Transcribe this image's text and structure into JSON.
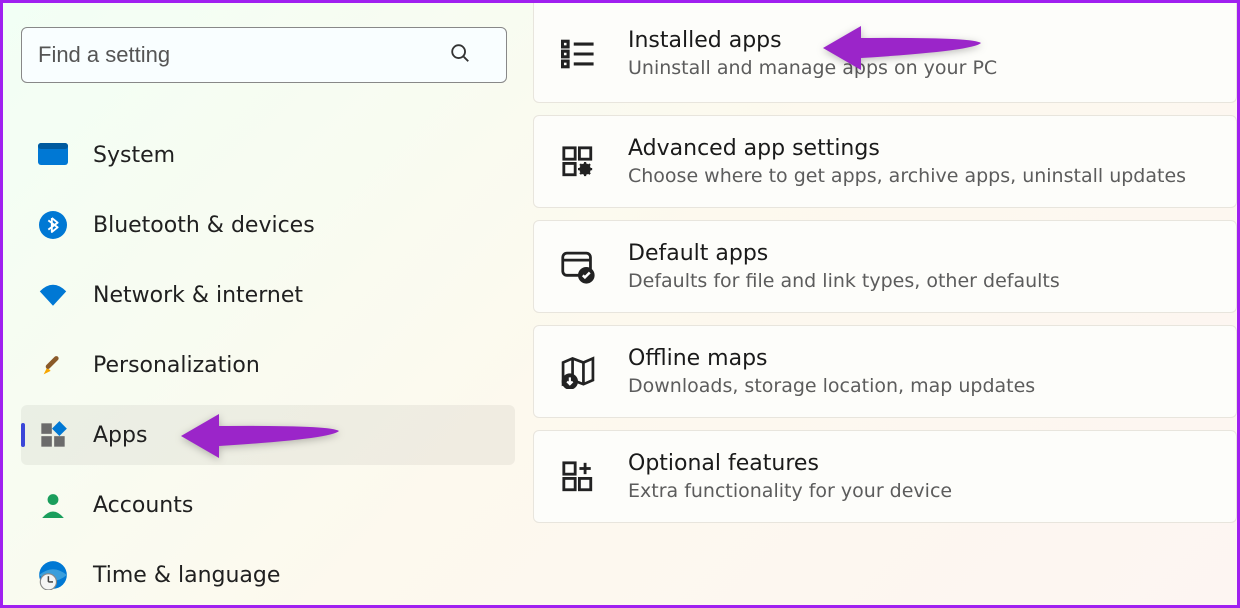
{
  "search": {
    "placeholder": "Find a setting"
  },
  "sidebar": {
    "items": [
      {
        "label": "System"
      },
      {
        "label": "Bluetooth & devices"
      },
      {
        "label": "Network & internet"
      },
      {
        "label": "Personalization"
      },
      {
        "label": "Apps"
      },
      {
        "label": "Accounts"
      },
      {
        "label": "Time & language"
      }
    ]
  },
  "cards": [
    {
      "title": "Installed apps",
      "sub": "Uninstall and manage apps on your PC"
    },
    {
      "title": "Advanced app settings",
      "sub": "Choose where to get apps, archive apps, uninstall updates"
    },
    {
      "title": "Default apps",
      "sub": "Defaults for file and link types, other defaults"
    },
    {
      "title": "Offline maps",
      "sub": "Downloads, storage location, map updates"
    },
    {
      "title": "Optional features",
      "sub": "Extra functionality for your device"
    }
  ]
}
